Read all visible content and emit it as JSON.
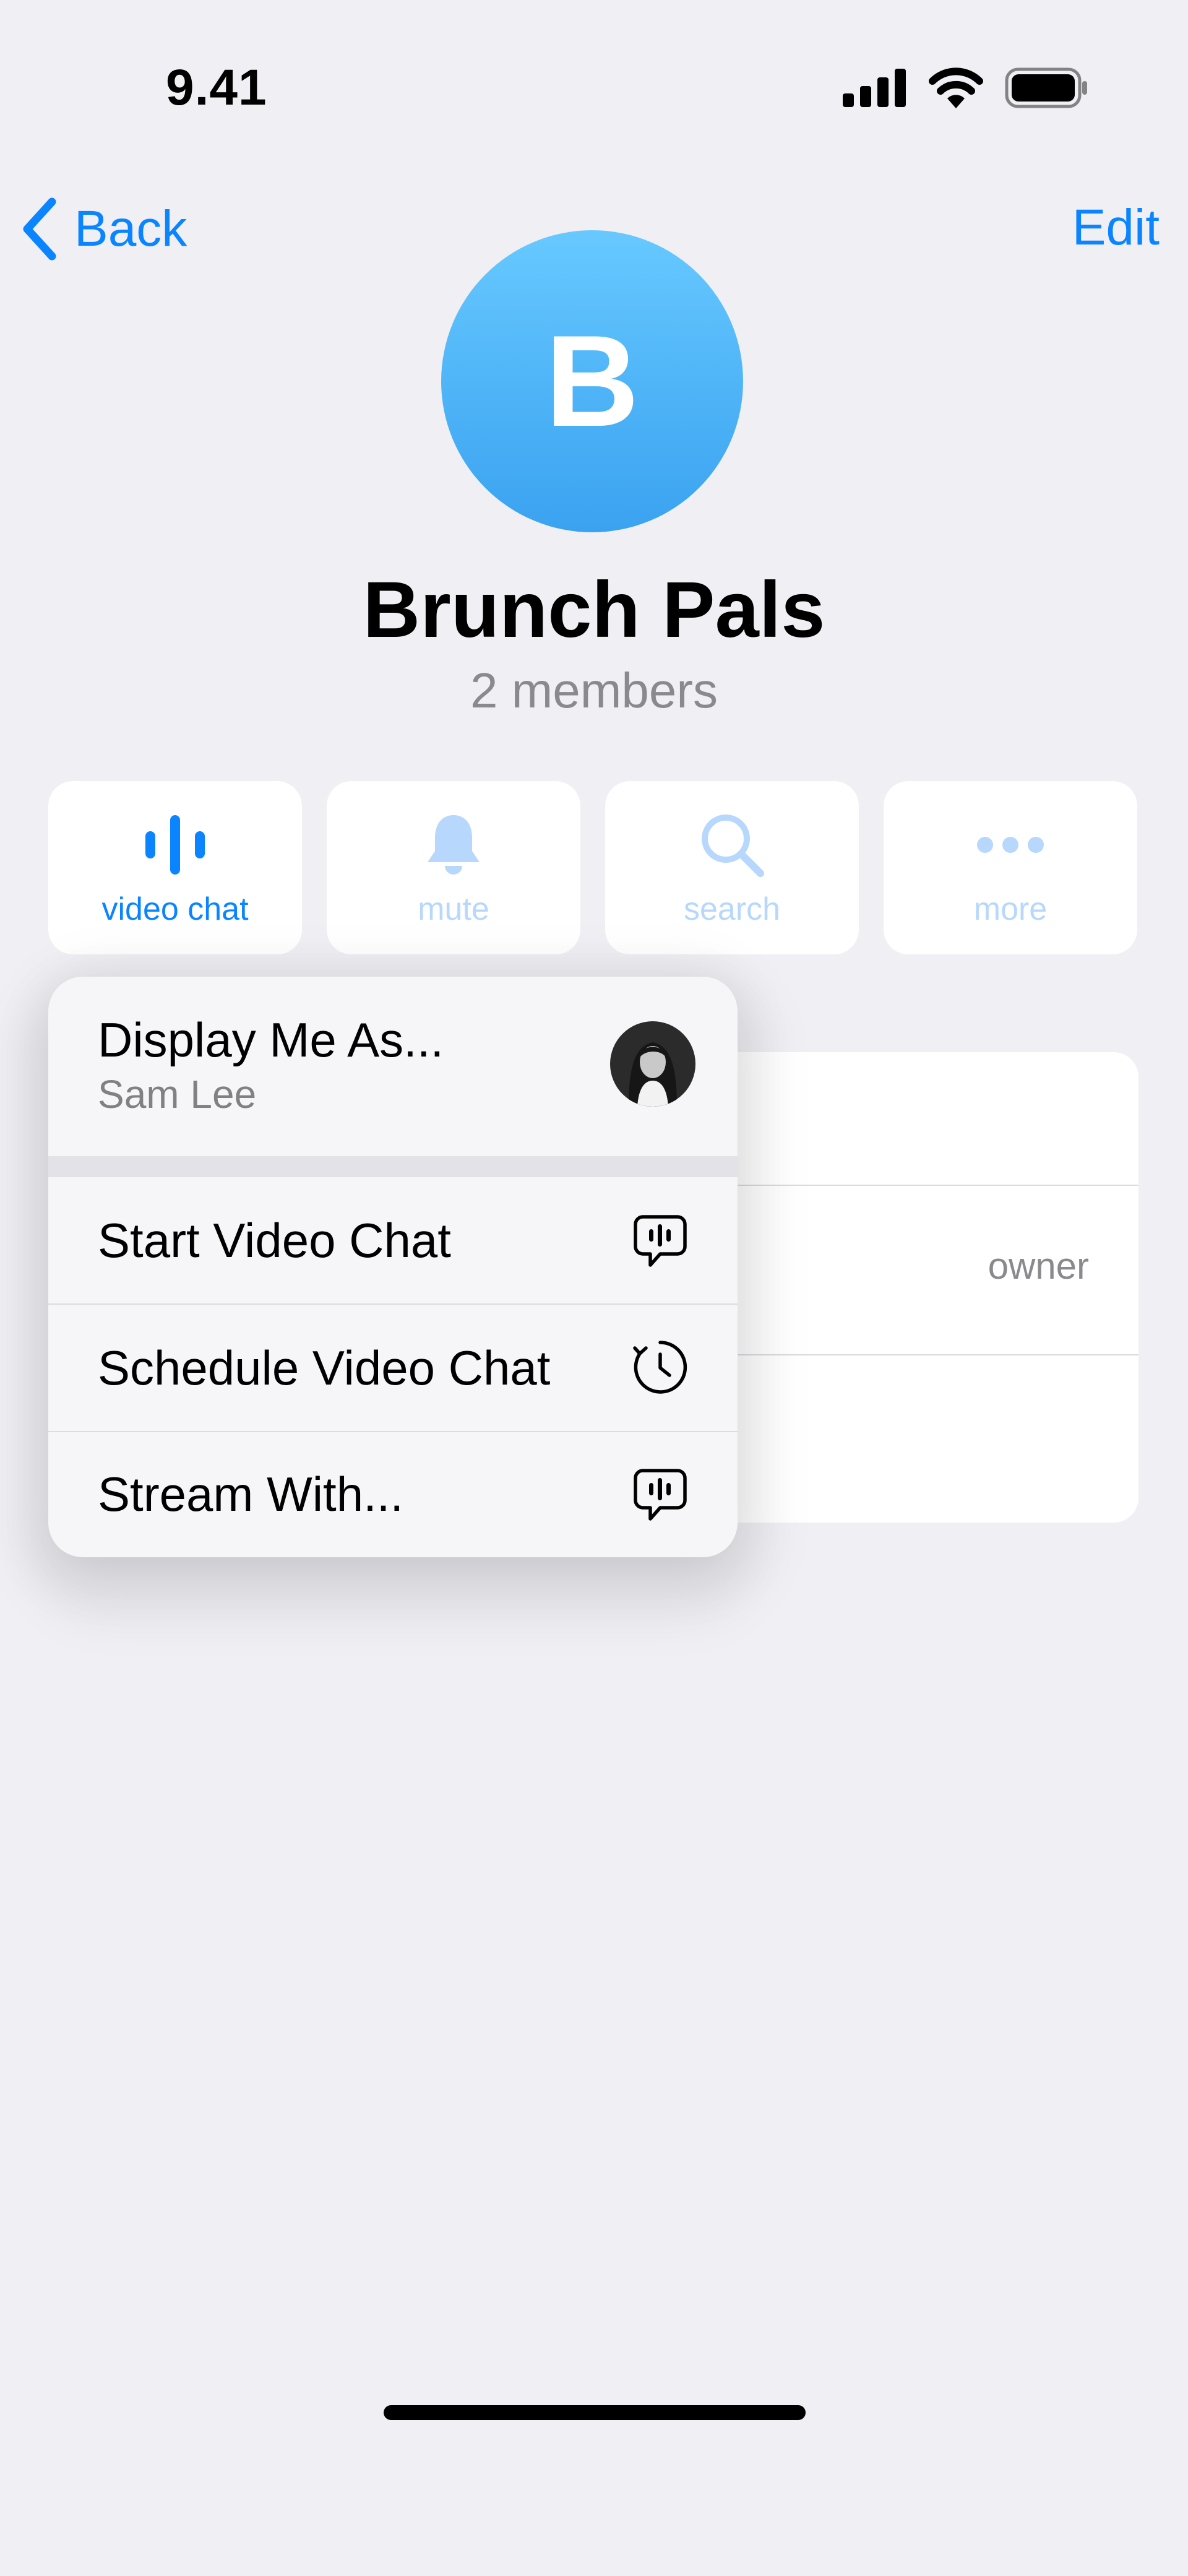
{
  "status_bar": {
    "time": "9.41",
    "icons": [
      "signal-icon",
      "wifi-icon",
      "battery-icon"
    ]
  },
  "nav": {
    "back_label": "Back",
    "edit_label": "Edit"
  },
  "group": {
    "avatar_letter": "B",
    "name": "Brunch Pals",
    "members": "2 members"
  },
  "actions": [
    {
      "label": "video chat",
      "icon": "video-chat-waveform-icon",
      "active": true
    },
    {
      "label": "mute",
      "icon": "bell-icon",
      "active": false
    },
    {
      "label": "search",
      "icon": "search-icon",
      "active": false
    },
    {
      "label": "more",
      "icon": "more-dots-icon",
      "active": false
    }
  ],
  "members_card": {
    "role_label": "owner"
  },
  "context_menu": {
    "display_as": {
      "title": "Display Me As...",
      "subtitle": "Sam Lee",
      "icon": "user-avatar"
    },
    "items": [
      {
        "label": "Start Video Chat",
        "icon": "video-chat-bubble-icon"
      },
      {
        "label": "Schedule Video Chat",
        "icon": "clock-schedule-icon"
      },
      {
        "label": "Stream With...",
        "icon": "stream-bubble-icon"
      }
    ]
  },
  "colors": {
    "accent": "#0A84FF",
    "accent_dim": "#B7D8FC",
    "background": "#EFEFF4",
    "secondary_text": "#8A8A8E",
    "avatar_gradient_top": "#67C9FF",
    "avatar_gradient_bottom": "#3AA2F0"
  }
}
